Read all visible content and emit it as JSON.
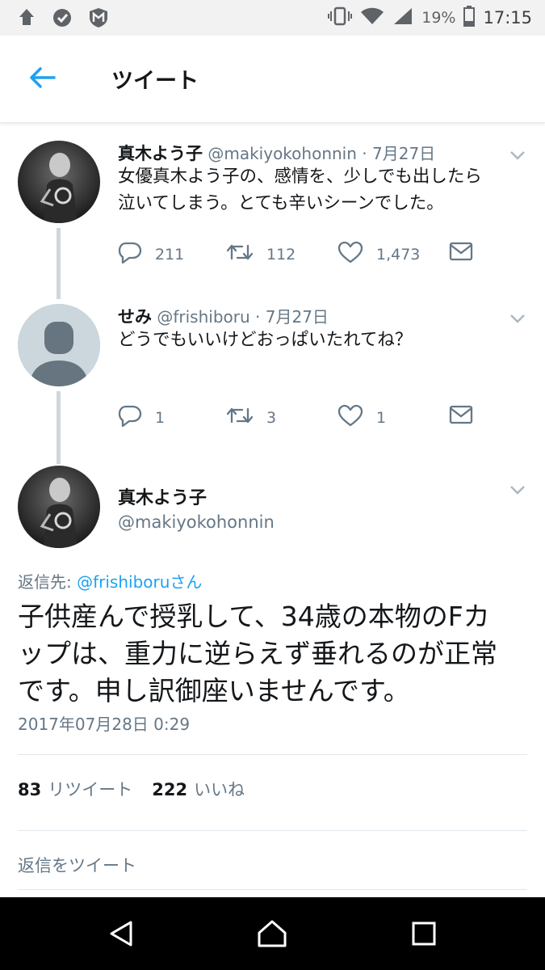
{
  "status_bar": {
    "battery_percent": "19%",
    "time": "17:15",
    "icons": [
      "notification-icon",
      "check-circle-icon",
      "mcafee-icon",
      "vibrate-icon",
      "wifi-icon",
      "signal-icon",
      "battery-icon"
    ]
  },
  "app_bar": {
    "back_icon": "arrow-left-icon",
    "title": "ツイート"
  },
  "thread": [
    {
      "name": "真木よう子",
      "handle": "@makiyokohonnin",
      "sep": " · ",
      "date": "7月27日",
      "text_lines": [
        "女優真木よう子の、感情を、少しでも出したら",
        "泣いてしまう。とても辛いシーンでした。"
      ],
      "replies": "211",
      "retweets": "112",
      "likes": "1,473"
    },
    {
      "name": "せみ",
      "handle": "@frishiboru",
      "sep": " · ",
      "date": "7月27日",
      "text_lines": [
        "どうでもいいけどおっぱいたれてね？"
      ],
      "replies": "1",
      "retweets": "3",
      "likes": "1"
    }
  ],
  "main_tweet": {
    "name": "真木よう子",
    "handle": "@makiyokohonnin",
    "reply_to_label": "返信先: ",
    "reply_to_user": "@frishiboruさん",
    "text_lines": [
      "子供産んで授乳して、34歳の本物のFカ",
      "ップは、重力に逆らえず垂れるのが正常",
      "です。申し訳御座いませんです。"
    ],
    "timestamp": "2017年07月28日 0:29",
    "retweet_count": "83",
    "retweet_label": "リツイート",
    "like_count": "222",
    "like_label": "いいね"
  },
  "reply_box": {
    "placeholder": "返信をツイート"
  },
  "nav_bar": {
    "icons": [
      "back-triangle-icon",
      "home-icon",
      "recents-icon"
    ]
  },
  "colors": {
    "accent": "#1da1f2",
    "text_primary": "#14171a",
    "text_secondary": "#657786",
    "thread_line": "#ccd6dd"
  }
}
